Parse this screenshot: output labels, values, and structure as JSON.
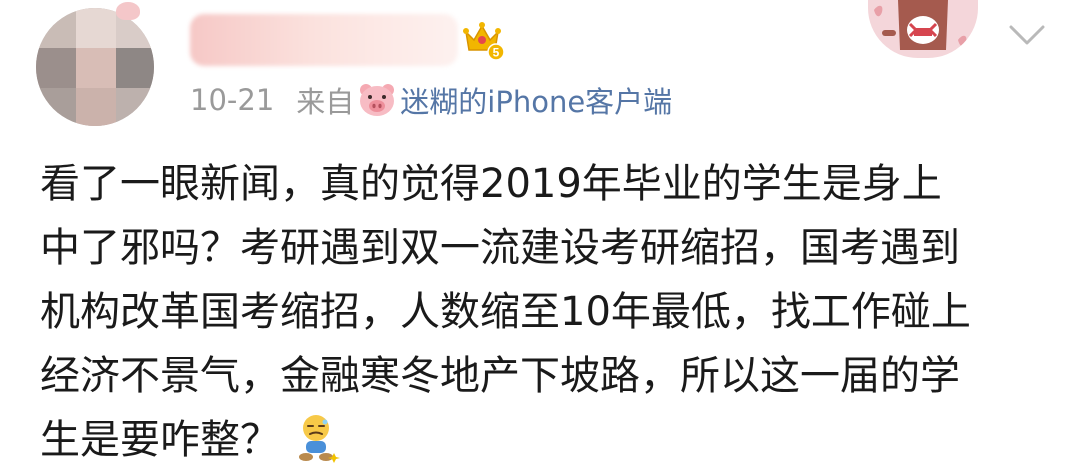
{
  "post": {
    "time": "10-21",
    "from_label": "来自",
    "source_icon": "pig-face-icon",
    "source": "迷糊的iPhone客户端",
    "crown_icon": "vip-crown-icon",
    "crown_level": "5",
    "content_lines": [
      "看了一眼新闻，真的觉得2019年毕业的学生是身上",
      "中了邪吗？考研遇到双一流建设考研缩招，国考遇到",
      "机构改革国考缩招，人数缩至10年最低，找工作碰上",
      "经济不景气，金融寒冬地产下坡路，所以这一届的学",
      "生是要咋整？"
    ],
    "end_emoji": "confused-sitting-emoji-icon"
  },
  "colors": {
    "source_link": "#5576a6",
    "meta_text": "#9a9a9a",
    "body_text": "#1a1a1a",
    "crown_gold": "#f2b600"
  }
}
